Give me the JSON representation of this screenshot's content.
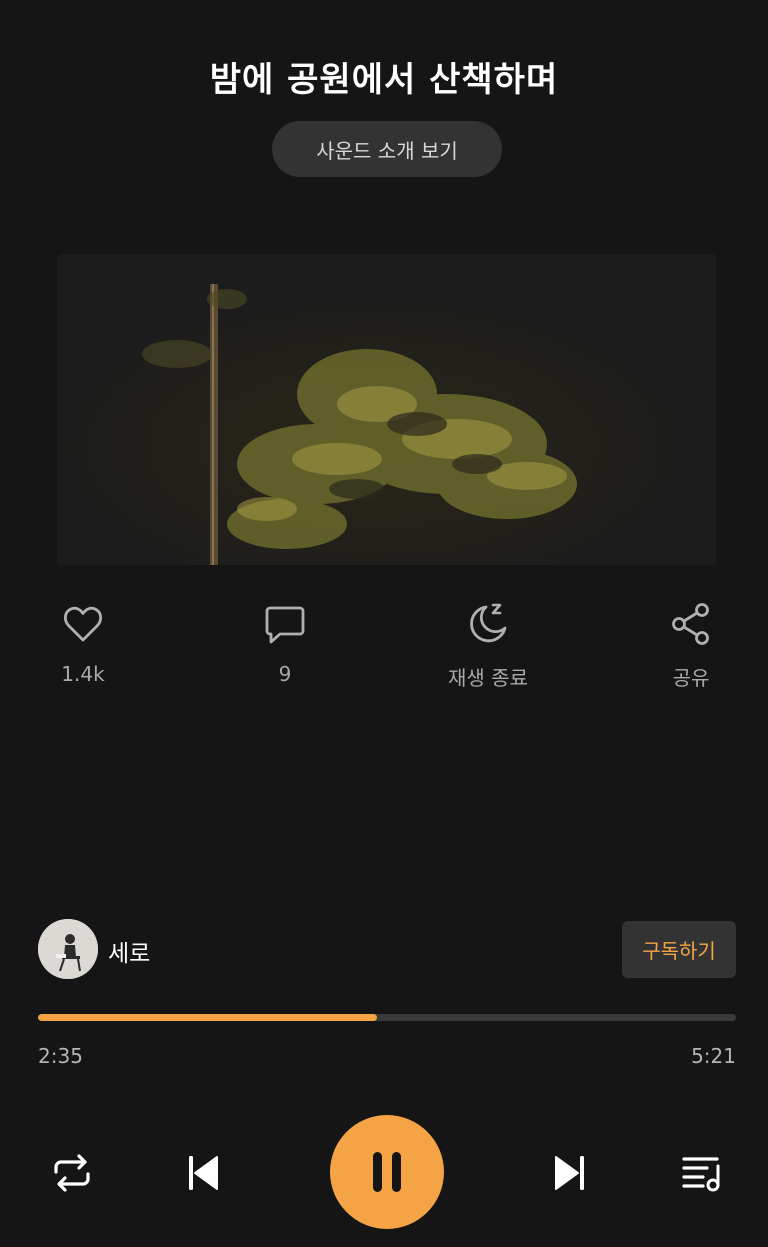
{
  "header": {
    "title": "밤에 공원에서 산책하며",
    "intro_button": "사운드 소개 보기"
  },
  "cover": {
    "icon": "album-cover-image",
    "description_icon": "night-park-tree-photo"
  },
  "actions": [
    {
      "icon": "heart-icon",
      "label": "1.4k"
    },
    {
      "icon": "comment-icon",
      "label": "9"
    },
    {
      "icon": "sleep-timer-icon",
      "label": "재생 종료"
    },
    {
      "icon": "share-icon",
      "label": "공유"
    }
  ],
  "artist": {
    "name": "세로",
    "subscribe_label": "구독하기"
  },
  "player": {
    "current_time": "2:35",
    "total_time": "5:21",
    "progress": 0.485
  },
  "colors": {
    "accent": "#f5a445",
    "background": "#151515",
    "surface": "#333333"
  }
}
